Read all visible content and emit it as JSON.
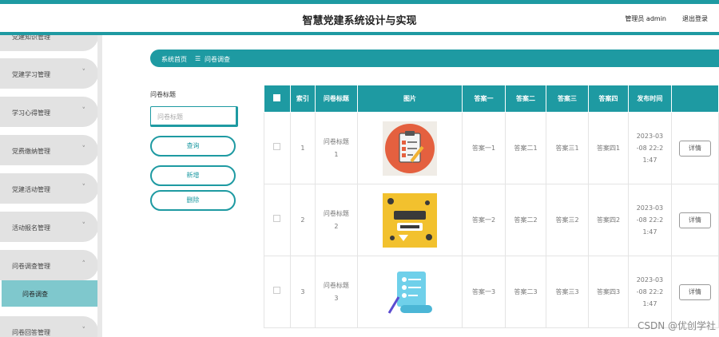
{
  "header": {
    "title": "智慧党建系统设计与实现",
    "user": "管理员 admin",
    "logout": "退出登录"
  },
  "sidebar": {
    "items": [
      {
        "label": "党建知识管理",
        "chevron": "˅"
      },
      {
        "label": "党建学习管理",
        "chevron": "˅"
      },
      {
        "label": "学习心得管理",
        "chevron": "˅"
      },
      {
        "label": "党费缴纳管理",
        "chevron": "˅"
      },
      {
        "label": "党建活动管理",
        "chevron": "˅"
      },
      {
        "label": "活动报名管理",
        "chevron": "˅"
      },
      {
        "label": "问卷调查管理",
        "chevron": "˄"
      },
      {
        "label": "问卷回答管理",
        "chevron": "˅"
      }
    ],
    "active_sub": "问卷调查"
  },
  "breadcrumb": {
    "home": "系统首页",
    "sep": "☰",
    "current": "问卷调查"
  },
  "search": {
    "label": "问卷标题",
    "placeholder": "问卷标题",
    "query": "查询",
    "add": "新增",
    "delete": "删除"
  },
  "table": {
    "headers": [
      "索引",
      "问卷标题",
      "图片",
      "答案一",
      "答案二",
      "答案三",
      "答案四",
      "发布时间",
      ""
    ],
    "rows": [
      {
        "index": "1",
        "title_a": "问卷标题",
        "title_b": "1",
        "a1": "答案一1",
        "a2": "答案二1",
        "a3": "答案三1",
        "a4": "答案四1",
        "t1": "2023-03",
        "t2": "-08 22:2",
        "t3": "1:47",
        "action": "详情",
        "image": "clipboard-checklist-image"
      },
      {
        "index": "2",
        "title_a": "问卷标题",
        "title_b": "2",
        "a1": "答案一2",
        "a2": "答案二2",
        "a3": "答案三2",
        "a4": "答案四2",
        "t1": "2023-03",
        "t2": "-08 22:2",
        "t3": "1:47",
        "action": "详情",
        "image": "survey-poster-image"
      },
      {
        "index": "3",
        "title_a": "问卷标题",
        "title_b": "3",
        "a1": "答案一3",
        "a2": "答案二3",
        "a3": "答案三3",
        "a4": "答案四3",
        "t1": "2023-03",
        "t2": "-08 22:2",
        "t3": "1:47",
        "action": "详情",
        "image": "scroll-list-image"
      }
    ]
  },
  "watermark": "CSDN @优创学社"
}
